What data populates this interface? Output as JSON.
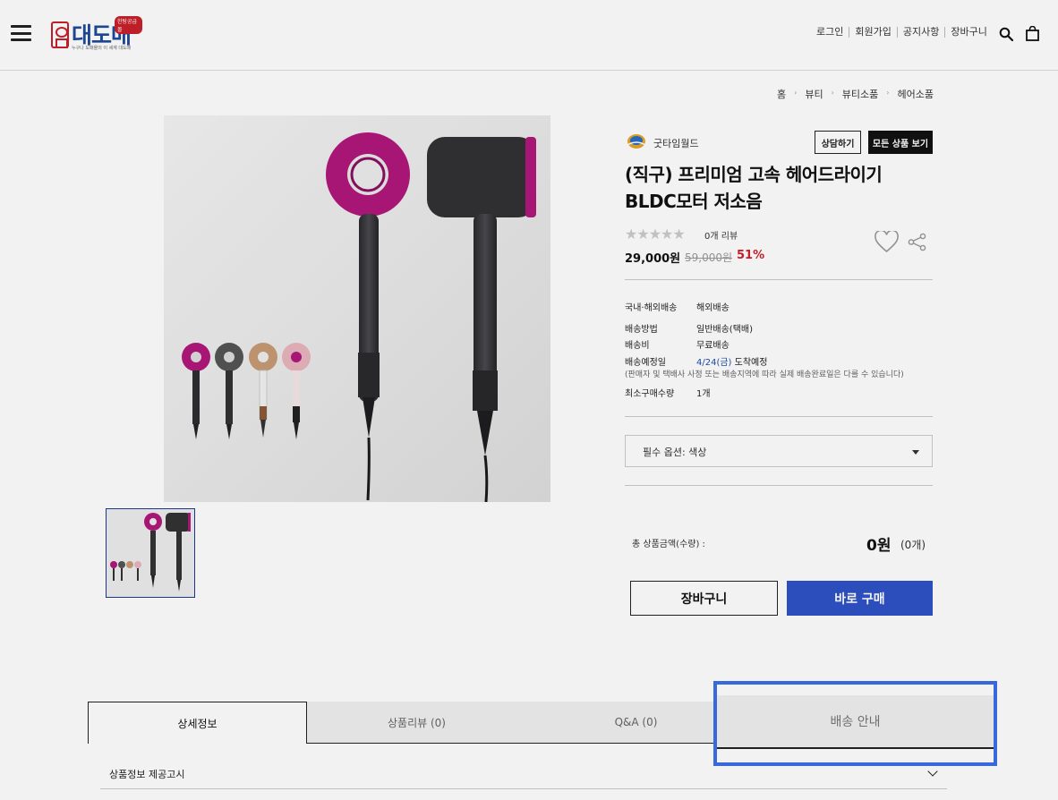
{
  "header": {
    "logo_text": "대도매",
    "logo_badge": "한탕공급몰",
    "logo_tagline": "누구나 도매몰의 이 세계 대도매",
    "links": [
      "로그인",
      "회원가입",
      "공지사항",
      "장바구니"
    ]
  },
  "breadcrumb": [
    "홈",
    "뷰티",
    "뷰티소품",
    "헤어소품"
  ],
  "product": {
    "seller": "굿타임월드",
    "consult_label": "상담하기",
    "all_products_label": "모든 상품 보기",
    "title_line1": "(직구) 프리미엄 고속 헤어드라이기",
    "title_line2": "BLDC모터 저소음",
    "stars": "★★★★★",
    "rating": 0,
    "review_count": "0개 리뷰",
    "price": "29,000원",
    "original_price": "59,000원",
    "discount": "51%"
  },
  "specs": {
    "shipping_type_label": "국내·해외배송",
    "shipping_type_value": "해외배송",
    "method_label": "배송방법",
    "method_value": "일반배송(택배)",
    "fee_label": "배송비",
    "fee_value": "무료배송",
    "eta_label": "배송예정일",
    "eta_date": "4/24(금)",
    "eta_suffix": "도착예정",
    "note": "(판매자 및 택배사 사정 또는 배송지역에 따라 실제 배송완료일은 다를 수 있습니다)",
    "min_qty_label": "최소구매수량",
    "min_qty_value": "1개"
  },
  "option": {
    "label": "필수 옵션: 색상"
  },
  "total": {
    "label": "총 상품금액(수량) :",
    "amount": "0원",
    "count": "(0개)"
  },
  "actions": {
    "cart_label": "장바구니",
    "buy_label": "바로 구매"
  },
  "tabs": {
    "detail": "상세정보",
    "review": "상품리뷰 (0)",
    "qna": "Q&A (0)",
    "shipping": "배송 안내"
  },
  "info_row": {
    "label": "상품정보 제공고시"
  },
  "colors": {
    "accent_blue": "#2f53c8",
    "highlight": "#3a6ee8",
    "discount_red": "#d0202a",
    "brand_navy": "#1e4a9a",
    "brand_red": "#c8202a",
    "dryer_magenta": "#b0177c",
    "dryer_body": "#3a3a3e"
  }
}
